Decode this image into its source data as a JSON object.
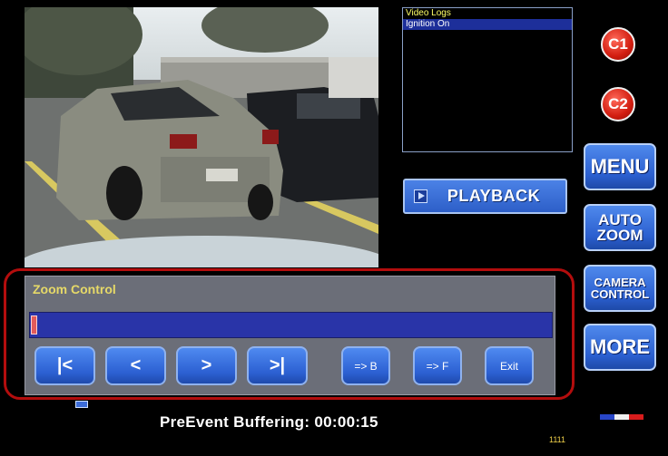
{
  "camera": {
    "icon": "parking-lot-camera-feed"
  },
  "log_list": {
    "header": "Video Logs",
    "items": [
      "Ignition On"
    ]
  },
  "playback": {
    "label": "PLAYBACK",
    "icon": "play-icon"
  },
  "side_buttons": {
    "c1": "C1",
    "c2": "C2",
    "menu": "MENU",
    "auto_zoom": [
      "AUTO",
      "ZOOM"
    ],
    "camera_control": [
      "CAMERA",
      "CONTROL"
    ],
    "more": "MORE"
  },
  "zoom_control": {
    "title": "Zoom Control",
    "level": 0,
    "buttons": {
      "first": "|<",
      "prev": "<",
      "next": ">",
      "last": ">|",
      "to_b": "=> B",
      "to_f": "=> F",
      "exit": "Exit"
    }
  },
  "status": {
    "buffering": "PreEvent Buffering: 00:00:15",
    "counter": "1111"
  },
  "colors": {
    "highlight_outline": "#b30d0d",
    "button_blue": "#2c60d2",
    "track_blue": "#2934a8",
    "title_yellow": "#e6d968"
  }
}
